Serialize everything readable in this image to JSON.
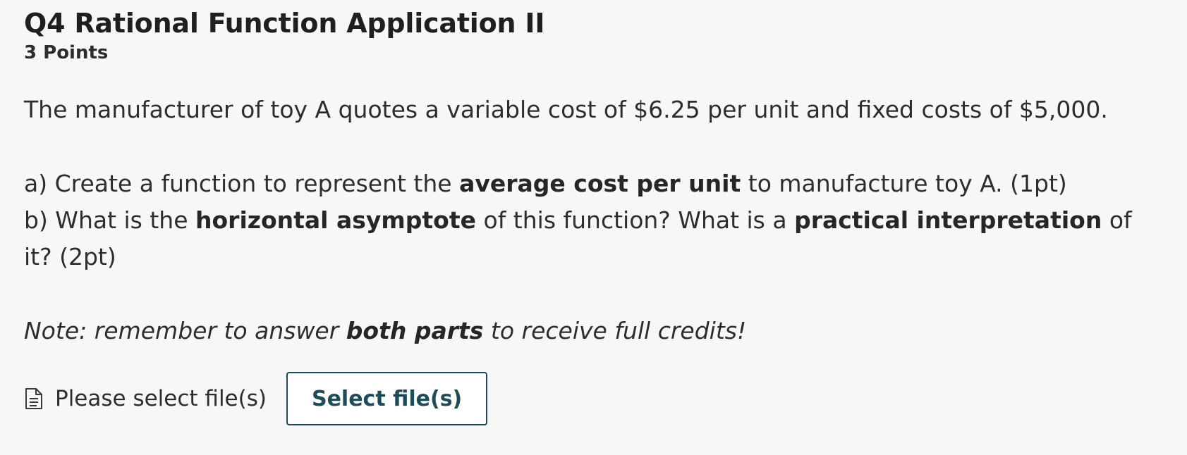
{
  "question": {
    "title": "Q4 Rational Function Application II",
    "points": "3 Points",
    "intro": "The manufacturer of toy A quotes a variable cost of $6.25 per unit and fixed costs of $5,000.",
    "part_a": {
      "prefix": "a) Create a function to represent the ",
      "bold": "average cost per unit",
      "suffix": " to manufacture toy A. (1pt)"
    },
    "part_b": {
      "prefix": "b) What is the ",
      "bold1": "horizontal asymptote",
      "middle": " of this function? What is a ",
      "bold2": "practical interpretation",
      "suffix": " of it? (2pt)"
    },
    "note": {
      "prefix": "Note: remember to answer ",
      "bold": "both parts",
      "suffix": " to receive full credits!"
    }
  },
  "upload": {
    "icon": "document-icon",
    "status_text": "Please select file(s)",
    "button_label": "Select file(s)"
  },
  "colors": {
    "background": "#f7f7f7",
    "text": "#2d2d2d",
    "button_accent": "#1d4b57"
  }
}
